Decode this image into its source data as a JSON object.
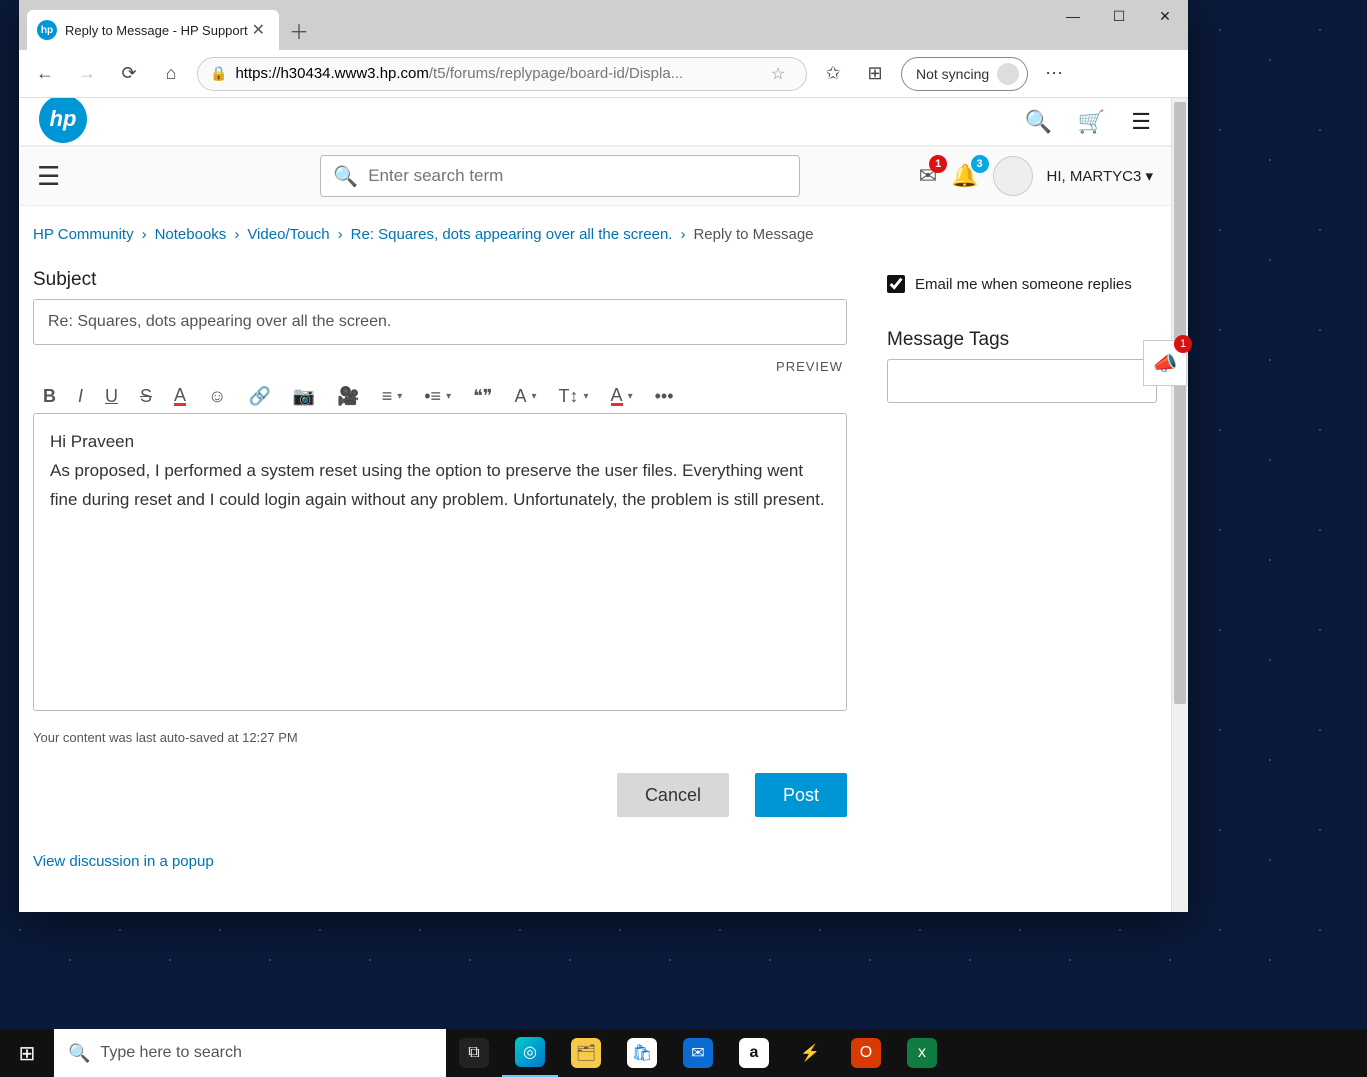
{
  "browser": {
    "tab_title": "Reply to Message - HP Support",
    "url_host": "https://h30434.www3.hp.com",
    "url_path": "/t5/forums/replypage/board-id/Displa...",
    "sync_label": "Not syncing"
  },
  "hp": {
    "search_placeholder": "Enter search term",
    "inbox_badge": "1",
    "bell_badge": "3",
    "user_greeting": "HI, MARTYC3"
  },
  "crumbs": {
    "c1": "HP Community",
    "c2": "Notebooks",
    "c3": "Video/Touch",
    "c4": "Re: Squares, dots appearing over all the screen.",
    "current": "Reply to Message"
  },
  "form": {
    "subject_label": "Subject",
    "subject_value": "Re: Squares, dots appearing over all the screen.",
    "preview": "PREVIEW",
    "body": "Hi Praveen\nAs proposed, I performed a system reset using the option to preserve the user files. Everything went fine during reset and I could login again without any problem. Unfortunately, the problem is still present.",
    "autosave": "Your content was last auto-saved at 12:27 PM",
    "cancel": "Cancel",
    "post": "Post",
    "popup": "View discussion in a popup"
  },
  "side": {
    "email_me": "Email me when someone replies",
    "tags_label": "Message Tags"
  },
  "feedback_badge": "1",
  "taskbar": {
    "search_placeholder": "Type here to search"
  }
}
